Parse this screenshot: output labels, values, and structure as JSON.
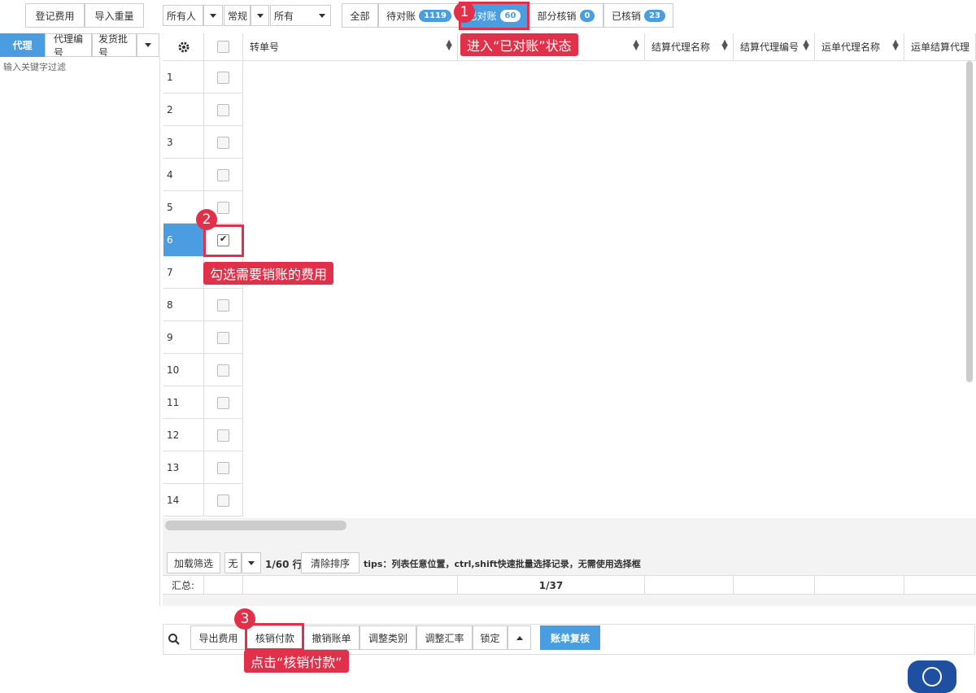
{
  "toolbar": {
    "register_fee": "登记费用",
    "import_weight": "导入重量",
    "filter_owner": "所有人",
    "filter_type": "常规",
    "filter_scope": "所有"
  },
  "status_tabs": {
    "all": "全部",
    "pending": "待对账",
    "pending_count": "1119",
    "reconciled": "已对账",
    "reconciled_count": "60",
    "partial": "部分核销",
    "partial_count": "0",
    "written_off": "已核销",
    "written_off_count": "23"
  },
  "left_panel": {
    "tabs": [
      "代理",
      "代理编号",
      "发货批号"
    ],
    "filter_placeholder": "输入关键字过滤"
  },
  "grid": {
    "columns": [
      "转单号",
      "",
      "结算代理名称",
      "结算代理编号",
      "运单代理名称",
      "运单结算代理"
    ],
    "rows": [
      "1",
      "2",
      "3",
      "4",
      "5",
      "6",
      "7",
      "8",
      "9",
      "10",
      "11",
      "12",
      "13",
      "14"
    ],
    "selected_row": "6"
  },
  "footer": {
    "load_filter": "加载筛选",
    "none_option": "无",
    "row_count": "1/60 行",
    "clear_sort": "清除排序",
    "tips": "tips：列表任意位置，ctrl,shift快速批量选择记录，无需使用选择框",
    "summary_label": "汇总:",
    "summary_page": "1/37"
  },
  "actions": {
    "export": "导出费用",
    "write_off_pay": "核销付款",
    "cancel_bill": "撤销账单",
    "adjust_category": "调整类别",
    "adjust_rate": "调整汇率",
    "lock": "锁定",
    "review": "账单复核"
  },
  "annotations": {
    "step1_num": "1",
    "step1_text": "进入“已对账”状态",
    "step2_num": "2",
    "step2_text": "勾选需要销账的费用",
    "step3_num": "3",
    "step3_text": "点击“核销付款”"
  },
  "colors": {
    "accent": "#4a9de0",
    "annotation_red": "#e0304a"
  }
}
